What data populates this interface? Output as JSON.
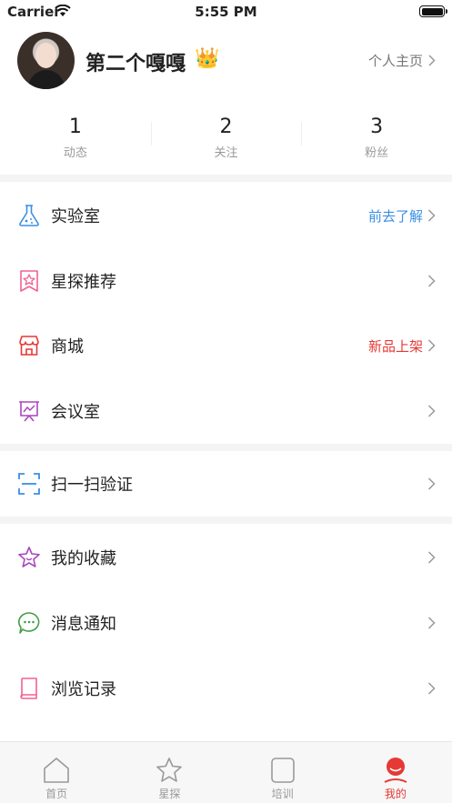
{
  "status_bar": {
    "carrier": "Carrier",
    "time": "5:55 PM"
  },
  "profile": {
    "username": "第二个嘎嘎",
    "crown": "👑",
    "homepage_link": "个人主页"
  },
  "stats": [
    {
      "value": "1",
      "label": "动态"
    },
    {
      "value": "2",
      "label": "关注"
    },
    {
      "value": "3",
      "label": "粉丝"
    }
  ],
  "menu": {
    "lab": {
      "label": "实验室",
      "extra": "前去了解",
      "extra_color": "#3a8ee6",
      "icon": "flask-icon"
    },
    "star_recommend": {
      "label": "星探推荐",
      "icon": "star-badge-icon"
    },
    "mall": {
      "label": "商城",
      "extra": "新品上架",
      "extra_color": "#e53935",
      "icon": "shop-icon"
    },
    "meeting": {
      "label": "会议室",
      "icon": "presentation-icon"
    },
    "scan": {
      "label": "扫一扫验证",
      "icon": "scan-icon"
    },
    "favorites": {
      "label": "我的收藏",
      "icon": "star-icon"
    },
    "notifications": {
      "label": "消息通知",
      "icon": "chat-bubble-icon"
    },
    "history": {
      "label": "浏览记录",
      "icon": "book-icon"
    }
  },
  "tabs": [
    {
      "label": "首页",
      "icon": "home-icon"
    },
    {
      "label": "星探",
      "icon": "star-outline-icon"
    },
    {
      "label": "培训",
      "icon": "training-icon"
    },
    {
      "label": "我的",
      "icon": "profile-icon",
      "active": true
    }
  ]
}
